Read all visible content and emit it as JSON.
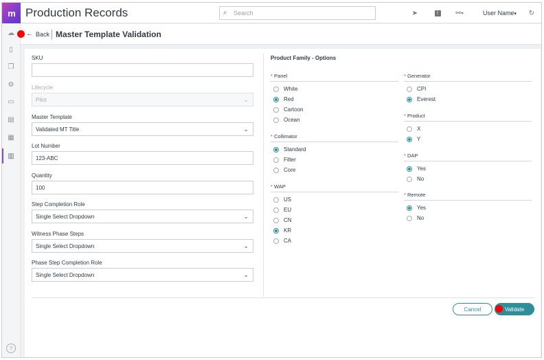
{
  "app": {
    "title": "Production Records",
    "logo_letter": "m"
  },
  "topbar": {
    "search_placeholder": "Search",
    "user_label": "User Name",
    "user_caret": "▾"
  },
  "page": {
    "back_label": "Back",
    "title": "Master Template Validation"
  },
  "form": {
    "sku": {
      "label": "SKU",
      "value": ""
    },
    "lifecycle": {
      "label": "Lifecycle",
      "value": "Pilot"
    },
    "master_template": {
      "label": "Master Template",
      "value": "Validated MT Title"
    },
    "lot_number": {
      "label": "Lot Number",
      "value": "123-ABC"
    },
    "quantity": {
      "label": "Quantity",
      "value": "100"
    },
    "step_completion_role": {
      "label": "Step Completion Role",
      "value": "Single Select Dropdown"
    },
    "witness_phase_steps": {
      "label": "Witness Phase Steps",
      "value": "Single Select Dropdown"
    },
    "phase_step_completion_role": {
      "label": "Phase Step Completion Role",
      "value": "Single Select Dropdown"
    }
  },
  "options": {
    "title": "Product Family - Options",
    "required_mark": "*",
    "panel": {
      "label": "Panel",
      "options": [
        "White",
        "Red",
        "Cartoon",
        "Ocean"
      ],
      "selected": "Red"
    },
    "collimator": {
      "label": "Collimator",
      "options": [
        "Standard",
        "Filter",
        "Core"
      ],
      "selected": "Standard"
    },
    "wap": {
      "label": "WAP",
      "options": [
        "US",
        "EU",
        "CN",
        "KR",
        "CA"
      ],
      "selected": "KR"
    },
    "generator": {
      "label": "Generator",
      "options": [
        "CPI",
        "Everest"
      ],
      "selected": "Everest"
    },
    "product": {
      "label": "Product",
      "options": [
        "X",
        "Y"
      ],
      "selected": "Y"
    },
    "dap": {
      "label": "DAP",
      "options": [
        "Yes",
        "No"
      ],
      "selected": "Yes"
    },
    "remote": {
      "label": "Remote",
      "options": [
        "Yes",
        "No"
      ],
      "selected": "Yes"
    }
  },
  "actions": {
    "cancel_label": "Cancel",
    "validate_label": "Validate"
  },
  "icons": {
    "search": "search-icon",
    "navigate": "navigation-arrow-icon",
    "alert": "alert-icon",
    "settings": "connection-icon",
    "refresh": "refresh-icon",
    "back": "back-arrow-icon",
    "chevron": "chevron-down-icon",
    "help": "help-icon"
  },
  "colors": {
    "accent": "#2e8f9a",
    "required": "#e0343f",
    "logo_start": "#c042b8",
    "logo_end": "#5b39c6",
    "marker": "#ff0000"
  }
}
